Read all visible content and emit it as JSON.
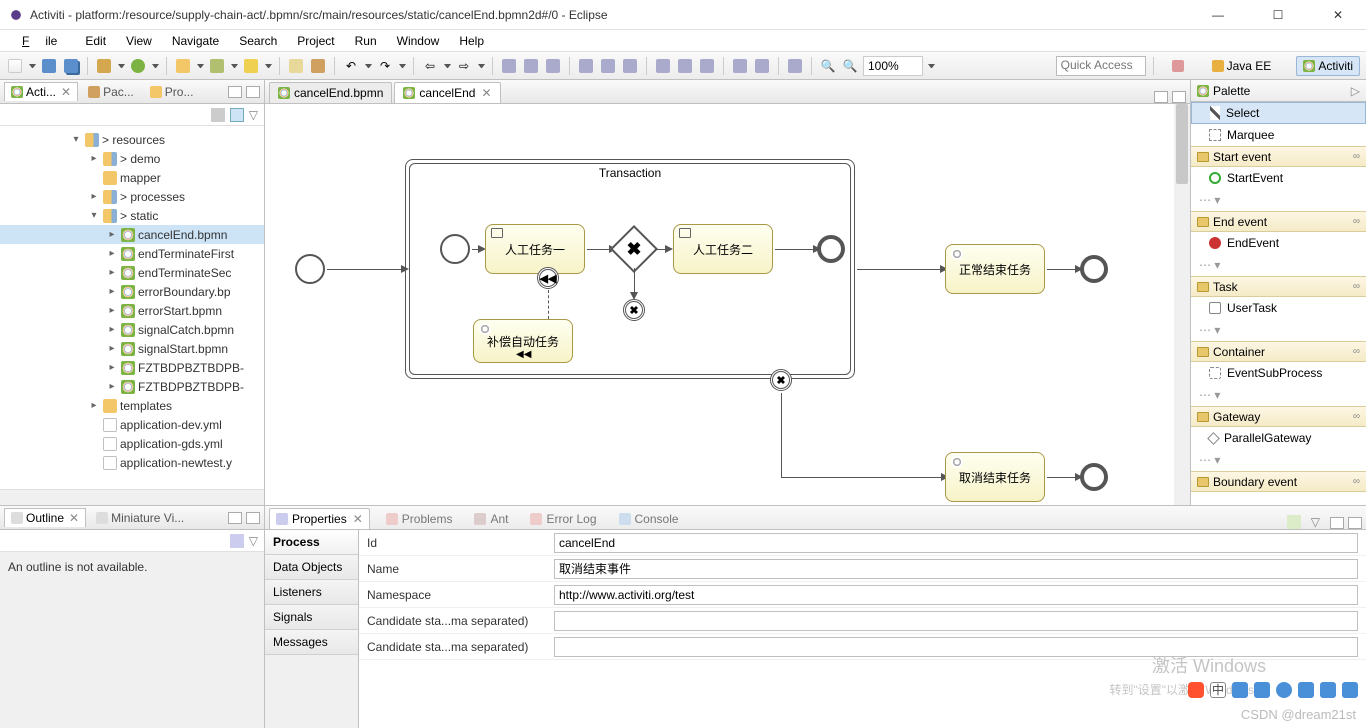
{
  "title": "Activiti - platform:/resource/supply-chain-act/.bpmn/src/main/resources/static/cancelEnd.bpmn2d#/0 - Eclipse",
  "menu": {
    "file": "File",
    "edit": "Edit",
    "view": "View",
    "navigate": "Navigate",
    "search": "Search",
    "project": "Project",
    "run": "Run",
    "window": "Window",
    "help": "Help"
  },
  "toolbar": {
    "zoom": "100%",
    "quick": "Quick Access"
  },
  "perspectives": {
    "java": "Java EE",
    "activiti": "Activiti"
  },
  "nav": {
    "tabs": {
      "activiti": "Acti...",
      "package": "Pac...",
      "project": "Pro..."
    },
    "tree": [
      {
        "d": 0,
        "exp": "▾",
        "icon": "folder-src",
        "label": "> resources"
      },
      {
        "d": 1,
        "exp": "▸",
        "icon": "folder-src",
        "label": "> demo"
      },
      {
        "d": 1,
        "exp": "",
        "icon": "folder",
        "label": "mapper"
      },
      {
        "d": 1,
        "exp": "▸",
        "icon": "folder-src",
        "label": "> processes"
      },
      {
        "d": 1,
        "exp": "▾",
        "icon": "folder-src",
        "label": "> static"
      },
      {
        "d": 2,
        "exp": "▸",
        "icon": "bpmn",
        "label": "cancelEnd.bpmn",
        "sel": true
      },
      {
        "d": 2,
        "exp": "▸",
        "icon": "bpmn",
        "label": "endTerminateFirst"
      },
      {
        "d": 2,
        "exp": "▸",
        "icon": "bpmn",
        "label": "endTerminateSec"
      },
      {
        "d": 2,
        "exp": "▸",
        "icon": "bpmn",
        "label": "errorBoundary.bp"
      },
      {
        "d": 2,
        "exp": "▸",
        "icon": "bpmn",
        "label": "errorStart.bpmn"
      },
      {
        "d": 2,
        "exp": "▸",
        "icon": "bpmn",
        "label": "signalCatch.bpmn"
      },
      {
        "d": 2,
        "exp": "▸",
        "icon": "bpmn",
        "label": "signalStart.bpmn"
      },
      {
        "d": 2,
        "exp": "▸",
        "icon": "bpmn",
        "label": "FZTBDPBZTBDPB-"
      },
      {
        "d": 2,
        "exp": "▸",
        "icon": "bpmn",
        "label": "FZTBDPBZTBDPB-"
      },
      {
        "d": 1,
        "exp": "▸",
        "icon": "folder",
        "label": "templates"
      },
      {
        "d": 1,
        "exp": "",
        "icon": "file",
        "label": "application-dev.yml"
      },
      {
        "d": 1,
        "exp": "",
        "icon": "file",
        "label": "application-gds.yml"
      },
      {
        "d": 1,
        "exp": "",
        "icon": "file",
        "label": "application-newtest.y"
      }
    ]
  },
  "editor": {
    "tabs": [
      {
        "label": "cancelEnd.bpmn",
        "active": false
      },
      {
        "label": "cancelEnd",
        "active": true
      }
    ]
  },
  "diagram": {
    "transaction": "Transaction",
    "task1": "人工任务一",
    "task2": "人工任务二",
    "task3": "补偿自动任务",
    "task4": "正常结束任务",
    "task5": "取消结束任务"
  },
  "palette": {
    "title": "Palette",
    "select": "Select",
    "marquee": "Marquee",
    "groups": {
      "startEvent": "Start event",
      "startEventItem": "StartEvent",
      "endEvent": "End event",
      "endEventItem": "EndEvent",
      "task": "Task",
      "userTask": "UserTask",
      "container": "Container",
      "eventSub": "EventSubProcess",
      "gateway": "Gateway",
      "parallel": "ParallelGateway",
      "boundary": "Boundary event"
    }
  },
  "outline": {
    "tabs": {
      "outline": "Outline",
      "mini": "Miniature Vi..."
    },
    "msg": "An outline is not available."
  },
  "bottomTabs": {
    "properties": "Properties",
    "problems": "Problems",
    "ant": "Ant",
    "error": "Error Log",
    "console": "Console"
  },
  "props": {
    "cats": [
      "Process",
      "Data Objects",
      "Listeners",
      "Signals",
      "Messages"
    ],
    "rows": [
      {
        "label": "Id",
        "value": "cancelEnd"
      },
      {
        "label": "Name",
        "value": "取消结束事件"
      },
      {
        "label": "Namespace",
        "value": "http://www.activiti.org/test"
      },
      {
        "label": "Candidate sta...ma separated)",
        "value": ""
      },
      {
        "label": "Candidate sta...ma separated)",
        "value": ""
      }
    ]
  },
  "watermark": {
    "l1": "激活 Windows",
    "l2": "转到\"设置\"以激活 Windows。"
  },
  "credit": "CSDN @dream21st"
}
